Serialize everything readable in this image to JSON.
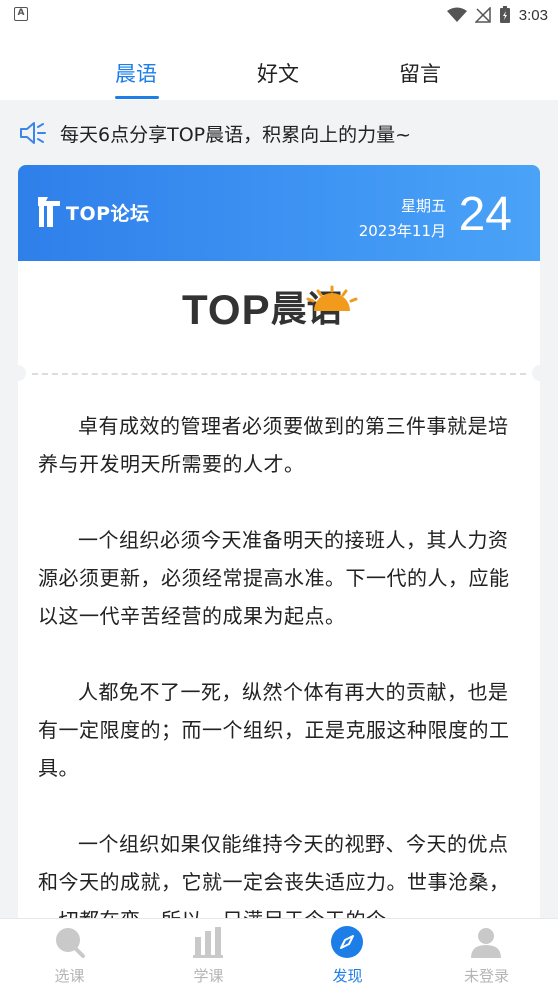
{
  "status": {
    "left_badge": "A",
    "time": "3:03"
  },
  "tabs": [
    {
      "label": "晨语",
      "active": true
    },
    {
      "label": "好文",
      "active": false
    },
    {
      "label": "留言",
      "active": false
    }
  ],
  "notice": {
    "icon": "speaker-icon",
    "text": "每天6点分享TOP晨语，积累向上的力量~"
  },
  "card": {
    "brand": "TOP论坛",
    "weekday": "星期五",
    "year_month": "2023年11月",
    "day": "24",
    "logo_latin": "TOP",
    "logo_cn": "晨语",
    "paragraphs": [
      "卓有成效的管理者必须要做到的第三件事就是培养与开发明天所需要的人才。",
      "一个组织必须今天准备明天的接班人，其人力资源必须更新，必须经常提高水准。下一代的人，应能以这一代辛苦经营的成果为起点。",
      "人都免不了一死，纵然个体有再大的贡献，也是有一定限度的；而一个组织，正是克服这种限度的工具。",
      "一个组织如果仅能维持今天的视野、今天的优点和今天的成就，它就一定会丧失适应力。世事沧桑，一切都在变。所以，只满足于今天的企"
    ]
  },
  "colors": {
    "accent": "#1e7ee8",
    "header_gradient_start": "#2f7fea",
    "header_gradient_end": "#4aa3f7",
    "inactive": "#b5b5b5"
  },
  "bottom_nav": [
    {
      "label": "选课",
      "icon": "search-icon",
      "active": false
    },
    {
      "label": "学课",
      "icon": "chart-icon",
      "active": false
    },
    {
      "label": "发现",
      "icon": "compass-icon",
      "active": true
    },
    {
      "label": "未登录",
      "icon": "user-icon",
      "active": false
    }
  ]
}
